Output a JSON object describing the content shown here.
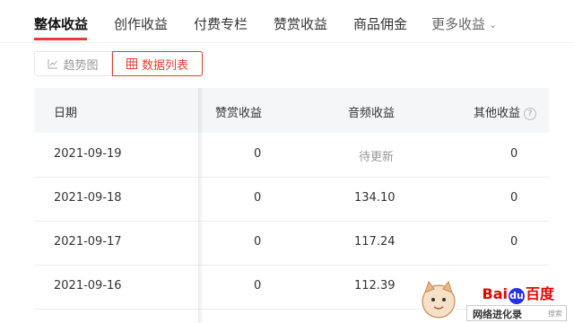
{
  "tabs": [
    {
      "label": "整体收益",
      "active": true
    },
    {
      "label": "创作收益",
      "active": false
    },
    {
      "label": "付费专栏",
      "active": false
    },
    {
      "label": "赞赏收益",
      "active": false
    },
    {
      "label": "商品佣金",
      "active": false
    },
    {
      "label": "更多收益",
      "active": false
    }
  ],
  "view_toggle": {
    "trend_label": "趋势图",
    "list_label": "数据列表",
    "selected": "数据列表"
  },
  "table": {
    "columns": [
      "日期",
      "赞赏收益",
      "音频收益",
      "其他收益"
    ],
    "rows": [
      {
        "date": "2021-09-19",
        "appreciation": "0",
        "audio": "待更新",
        "other": "0"
      },
      {
        "date": "2021-09-18",
        "appreciation": "0",
        "audio": "134.10",
        "other": "0"
      },
      {
        "date": "2021-09-17",
        "appreciation": "0",
        "audio": "117.24",
        "other": "0"
      },
      {
        "date": "2021-09-16",
        "appreciation": "0",
        "audio": "112.39",
        "other": ""
      }
    ]
  },
  "watermark": {
    "brand": "Baidu百度",
    "caption": "网络进化录",
    "search_hint": "搜索"
  },
  "colors": {
    "accent": "#e33e33",
    "header_bg": "#f5f6f7",
    "muted": "#999999"
  }
}
